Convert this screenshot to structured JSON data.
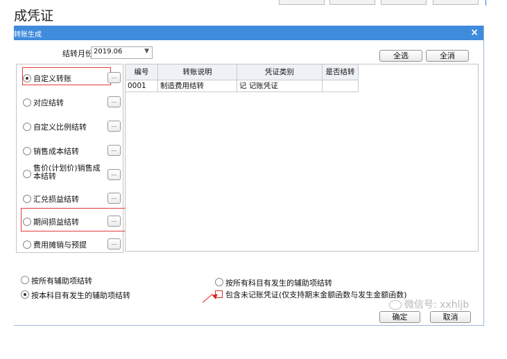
{
  "page": {
    "title": "成凭证"
  },
  "dialog": {
    "title": "转账生成",
    "close_glyph": "×",
    "month_label": "结转月份",
    "month_value": "2019.06",
    "select_all": "全选",
    "deselect_all": "全消",
    "left_items": [
      {
        "label": "自定义转账",
        "selected": true
      },
      {
        "label": "对应结转",
        "selected": false
      },
      {
        "label": "自定义比例结转",
        "selected": false
      },
      {
        "label": "销售成本结转",
        "selected": false
      },
      {
        "label": "售价(计划价)销售成本结转",
        "selected": false
      },
      {
        "label": "汇兑损益结转",
        "selected": false
      },
      {
        "label": "期间损益结转",
        "selected": false
      },
      {
        "label": "费用摊销与预提",
        "selected": false
      }
    ],
    "dots_label": "...",
    "table": {
      "columns": [
        "编号",
        "转账说明",
        "凭证类别",
        "是否结转"
      ],
      "rows": [
        [
          "0001",
          "制造费用结转",
          "记 记账凭证",
          ""
        ]
      ]
    },
    "options": {
      "all_aux": "按所有辅助项结转",
      "subject_aux": "按本科目有发生的辅助项结转",
      "all_subject_aux": "按所有科目有发生的辅助项结转",
      "include_unposted": "包含未记账凭证(仅支持期末金额函数与发生金额函数)"
    },
    "ok": "确定",
    "cancel": "取消",
    "watermark": "微信号: xxhljb"
  },
  "colors": {
    "titlebar": "#3f8bdc",
    "highlight": "#e23a3a"
  }
}
